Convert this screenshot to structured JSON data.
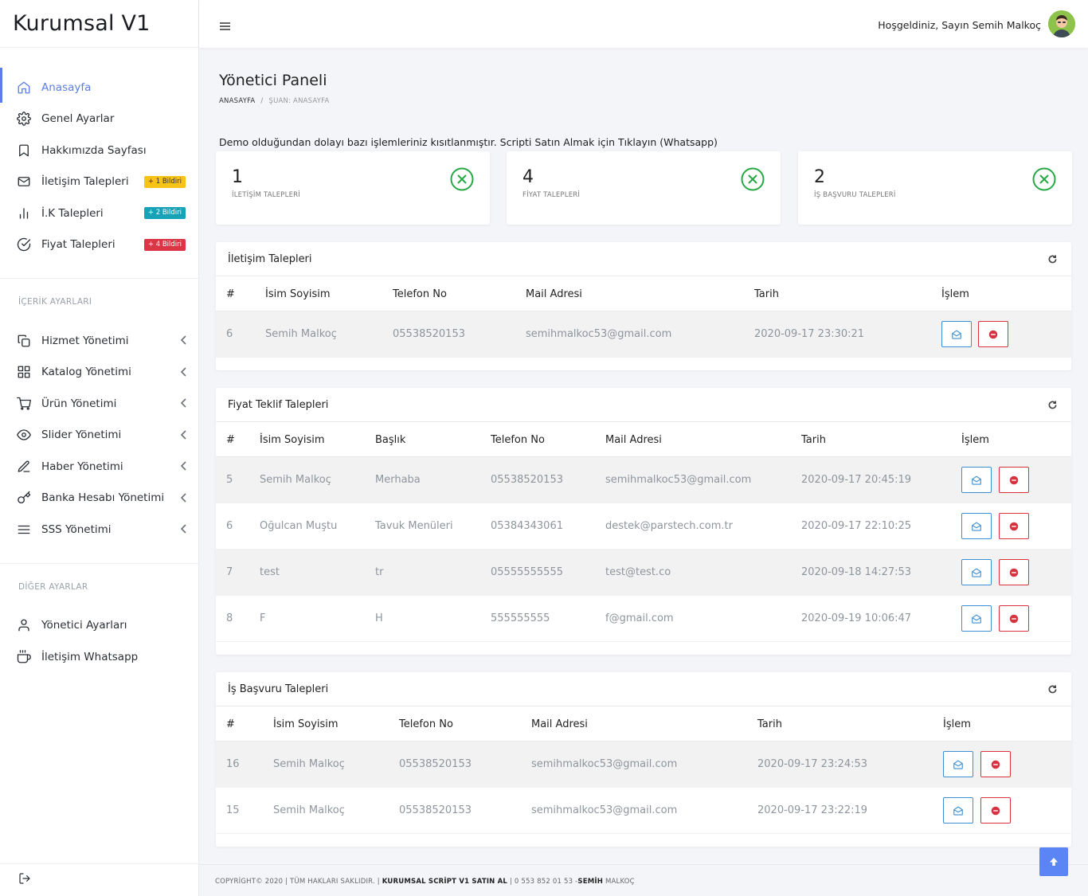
{
  "brand": "Kurumsal V1",
  "topbar": {
    "welcome": "Hoşgeldiniz, Sayın Semih Malkoç"
  },
  "sidebar": {
    "main": [
      {
        "label": "Anasayfa",
        "icon": "home-icon",
        "active": true
      },
      {
        "label": "Genel Ayarlar",
        "icon": "gear-icon"
      },
      {
        "label": "Hakkımızda Sayfası",
        "icon": "bookmark-icon"
      },
      {
        "label": "İletişim Talepleri",
        "icon": "mail-icon",
        "badge": "+ 1 Bildiri",
        "badge_color": "#f7c316"
      },
      {
        "label": "İ.K Talepleri",
        "icon": "bar-chart-icon",
        "badge": "+ 2 Bildiri",
        "badge_color": "#17a2b8"
      },
      {
        "label": "Fiyat Talepleri",
        "icon": "check-circle-icon",
        "badge": "+ 4 Bildiri",
        "badge_color": "#dc3545"
      }
    ],
    "content_section": "İÇERİK AYARLARI",
    "content": [
      {
        "label": "Hizmet Yönetimi",
        "icon": "copy-icon"
      },
      {
        "label": "Katalog Yönetimi",
        "icon": "grid-icon"
      },
      {
        "label": "Ürün Yönetimi",
        "icon": "cart-icon"
      },
      {
        "label": "Slider Yönetimi",
        "icon": "eye-icon"
      },
      {
        "label": "Haber Yönetimi",
        "icon": "pen-icon"
      },
      {
        "label": "Banka Hesabı Yönetimi",
        "icon": "key-icon"
      },
      {
        "label": "SSS Yönetimi",
        "icon": "menu-icon"
      }
    ],
    "other_section": "DİĞER AYARLAR",
    "other": [
      {
        "label": "Yönetici Ayarları",
        "icon": "user-icon"
      },
      {
        "label": "İletişim Whatsapp",
        "icon": "coffee-icon"
      }
    ]
  },
  "page": {
    "title": "Yönetici Paneli",
    "breadcrumb_home": "ANASAYFA",
    "breadcrumb_sep": "/",
    "breadcrumb_current": "ŞUAN: ANASAYFA",
    "demo_notice": "Demo olduğundan dolayı bazı işlemleriniz kısıtlanmıştır. Scripti Satın Almak için Tıklayın (Whatsapp)"
  },
  "stats": [
    {
      "value": "1",
      "label": "İLETİŞİM TALEPLERİ"
    },
    {
      "value": "4",
      "label": "FİYAT TALEPLERİ"
    },
    {
      "value": "2",
      "label": "İŞ BAŞVURU TALEPLERİ"
    }
  ],
  "contact": {
    "title": "İletişim Talepleri",
    "headers": [
      "#",
      "İsim Soyisim",
      "Telefon No",
      "Mail Adresi",
      "Tarih",
      "İşlem"
    ],
    "rows": [
      [
        "6",
        "Semih Malkoç",
        "05538520153",
        "semihmalkoc53@gmail.com",
        "2020-09-17 23:30:21"
      ]
    ]
  },
  "price": {
    "title": "Fiyat Teklif Talepleri",
    "headers": [
      "#",
      "İsim Soyisim",
      "Başlık",
      "Telefon No",
      "Mail Adresi",
      "Tarih",
      "İşlem"
    ],
    "rows": [
      [
        "5",
        "Semih Malkoç",
        "Merhaba",
        "05538520153",
        "semihmalkoc53@gmail.com",
        "2020-09-17 20:45:19"
      ],
      [
        "6",
        "Oğulcan Muştu",
        "Tavuk Menüleri",
        "05384343061",
        "destek@parstech.com.tr",
        "2020-09-17 22:10:25"
      ],
      [
        "7",
        "test",
        "tr",
        "05555555555",
        "test@test.co",
        "2020-09-18 14:27:53"
      ],
      [
        "8",
        "F",
        "H",
        "555555555",
        "f@gmail.com",
        "2020-09-19 10:06:47"
      ]
    ]
  },
  "jobs": {
    "title": "İş Başvuru Talepleri",
    "headers": [
      "#",
      "İsim Soyisim",
      "Telefon No",
      "Mail Adresi",
      "Tarih",
      "İşlem"
    ],
    "rows": [
      [
        "16",
        "Semih Malkoç",
        "05538520153",
        "semihmalkoc53@gmail.com",
        "2020-09-17 23:24:53"
      ],
      [
        "15",
        "Semih Malkoç",
        "05538520153",
        "semihmalkoc53@gmail.com",
        "2020-09-17 23:22:19"
      ]
    ]
  },
  "footer": {
    "left": "COPYRİGHT© 2020 | TÜM HAKLARI SAKLIDIR. | ",
    "link": "KURUMSAL SCRİPT V1 SATIN AL",
    "phone": " | 0 553 852 01 53 -",
    "author_bold": "SEMİH",
    "author_rest": " MALKOÇ"
  },
  "colors": {
    "accent": "#5b7ee5",
    "success": "#28a745",
    "danger": "#dc3545",
    "info": "#3d8fd1"
  }
}
